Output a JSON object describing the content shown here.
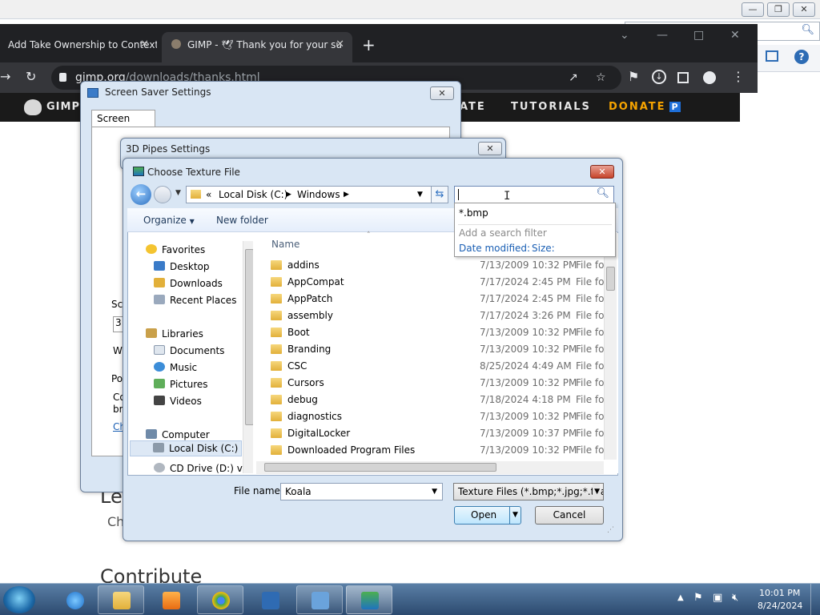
{
  "bg_window": {
    "controls": [
      "—",
      "❐",
      "✕"
    ],
    "icons": [
      "search-icon",
      "view-icon",
      "help-icon"
    ]
  },
  "chrome": {
    "tabs": [
      {
        "label": "Add Take Ownership to Context",
        "close": "✕"
      },
      {
        "label": "GIMP - 🕊 Thank you for your su",
        "close": "✕"
      }
    ],
    "new_tab": "+",
    "url_domain": "gimp.org",
    "url_path": "/downloads/thanks.html",
    "icons": [
      "back-icon",
      "reload-icon",
      "lock-icon",
      "share-icon",
      "star-icon",
      "extension-icon",
      "download-icon",
      "sidebar-icon",
      "profile-icon",
      "menu-icon"
    ]
  },
  "site": {
    "logo_text": "GIMP",
    "nav": [
      "ATE",
      "TUTORIALS",
      "DONATE"
    ],
    "donate_badge": "P",
    "heading_1": "Le",
    "para_1": "Ch",
    "heading_2": "Contribute"
  },
  "screensaver_dialog": {
    "title": "Screen Saver Settings",
    "tab": "Screen Saver",
    "close": "✕",
    "fragments": [
      "Sc",
      "3",
      "W",
      "Po",
      "Co",
      "br",
      "Ch"
    ]
  },
  "pipes_dialog": {
    "title": "3D Pipes Settings",
    "close": "✕"
  },
  "file_dialog": {
    "title": "Choose Texture File",
    "close": "✕",
    "breadcrumb": {
      "prefix": "«",
      "drive": "Local Disk (C:)",
      "folder": "Windows"
    },
    "search_value": "",
    "toolbar": {
      "organize": "Organize",
      "new_folder": "New folder"
    },
    "columns": {
      "name": "Name"
    },
    "nav": {
      "favorites": "Favorites",
      "desktop": "Desktop",
      "downloads": "Downloads",
      "recent": "Recent Places",
      "libraries": "Libraries",
      "documents": "Documents",
      "music": "Music",
      "pictures": "Pictures",
      "videos": "Videos",
      "computer": "Computer",
      "local_disk": "Local Disk (C:)",
      "cd_drive": "CD Drive (D:) virt"
    },
    "files": [
      {
        "name": "addins",
        "date": "7/13/2009 10:32 PM",
        "type": "File fol"
      },
      {
        "name": "AppCompat",
        "date": "7/17/2024 2:45 PM",
        "type": "File fol"
      },
      {
        "name": "AppPatch",
        "date": "7/17/2024 2:45 PM",
        "type": "File fol"
      },
      {
        "name": "assembly",
        "date": "7/17/2024 3:26 PM",
        "type": "File fol"
      },
      {
        "name": "Boot",
        "date": "7/13/2009 10:32 PM",
        "type": "File fol"
      },
      {
        "name": "Branding",
        "date": "7/13/2009 10:32 PM",
        "type": "File fol"
      },
      {
        "name": "CSC",
        "date": "8/25/2024 4:49 AM",
        "type": "File fol"
      },
      {
        "name": "Cursors",
        "date": "7/13/2009 10:32 PM",
        "type": "File fol"
      },
      {
        "name": "debug",
        "date": "7/18/2024 4:18 PM",
        "type": "File fol"
      },
      {
        "name": "diagnostics",
        "date": "7/13/2009 10:32 PM",
        "type": "File fol"
      },
      {
        "name": "DigitalLocker",
        "date": "7/13/2009 10:37 PM",
        "type": "File fol"
      },
      {
        "name": "Downloaded Program Files",
        "date": "7/13/2009 10:32 PM",
        "type": "File fol"
      }
    ],
    "filename_label": "File name:",
    "filename_value": "Koala",
    "filetype_value": "Texture Files (*.bmp;*.jpg;*.tga;",
    "open_label": "Open",
    "cancel_label": "Cancel",
    "search_suggestions": {
      "item": "*.bmp",
      "filter_hint": "Add a search filter",
      "filter_date": "Date modified:",
      "filter_size": "Size:"
    }
  },
  "taskbar": {
    "time": "10:01 PM",
    "date": "8/24/2024",
    "apps": [
      "explorer",
      "internet-explorer",
      "media-player",
      "chrome",
      "disk-tool",
      "control-panel",
      "display-settings"
    ]
  },
  "colors": {
    "chrome_dark": "#202124",
    "dialog_bg": "#d9e6f4",
    "accent_link": "#1a5fb4",
    "donate": "#f7a400"
  }
}
